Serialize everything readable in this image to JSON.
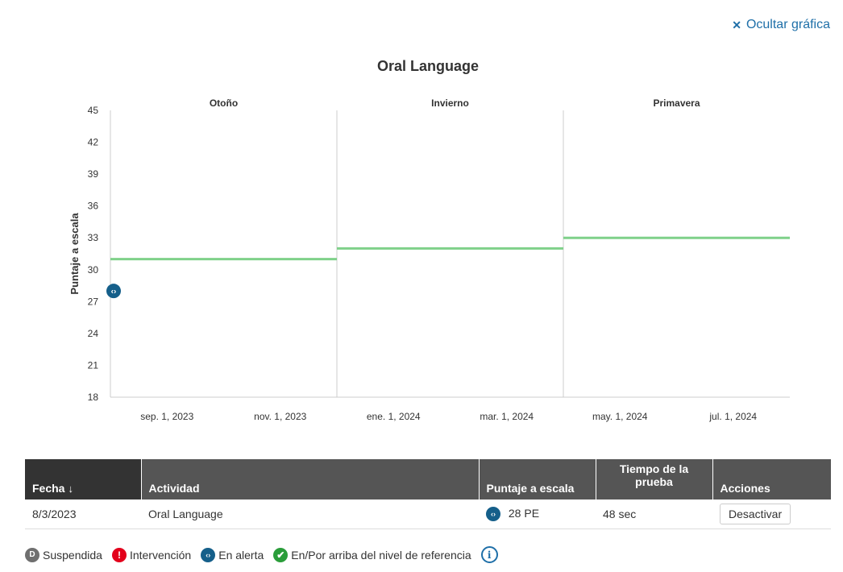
{
  "header": {
    "hide_chart_label": "Ocultar gráfica"
  },
  "chart_data": {
    "type": "line",
    "title": "Oral Language",
    "ylabel": "Puntaje a escala",
    "xlabel": "",
    "ylim": [
      18,
      45
    ],
    "yticks": [
      "18",
      "21",
      "24",
      "27",
      "30",
      "33",
      "36",
      "39",
      "42",
      "45"
    ],
    "xticks": [
      "sep. 1, 2023",
      "nov. 1, 2023",
      "ene. 1, 2024",
      "mar. 1, 2024",
      "may. 1, 2024",
      "jul. 1, 2024"
    ],
    "seasons": [
      "Otoño",
      "Invierno",
      "Primavera"
    ],
    "benchmark_series": [
      {
        "season": "Otoño",
        "value": 31,
        "color": "#7fd18a"
      },
      {
        "season": "Invierno",
        "value": 32,
        "color": "#7fd18a"
      },
      {
        "season": "Primavera",
        "value": 33,
        "color": "#7fd18a"
      }
    ],
    "points": [
      {
        "date": "8/3/2023",
        "value": 28,
        "status": "En alerta",
        "color": "#155f8a"
      }
    ],
    "grid": false
  },
  "table": {
    "headers": {
      "date": "Fecha",
      "activity": "Actividad",
      "score": "Puntaje a escala",
      "time": "Tiempo de la prueba",
      "actions": "Acciones"
    },
    "rows": [
      {
        "date": "8/3/2023",
        "activity": "Oral Language",
        "score": "28 PE",
        "time": "48 sec",
        "action": "Desactivar"
      }
    ]
  },
  "legend": {
    "suspended": "Suspendida",
    "intervention": "Intervención",
    "alert": "En alerta",
    "at_above": "En/Por arriba del nivel de referencia"
  },
  "colors": {
    "accent": "#1e6fa8",
    "alert": "#155f8a",
    "benchmark": "#7fd18a",
    "header_bg": "#555555"
  }
}
